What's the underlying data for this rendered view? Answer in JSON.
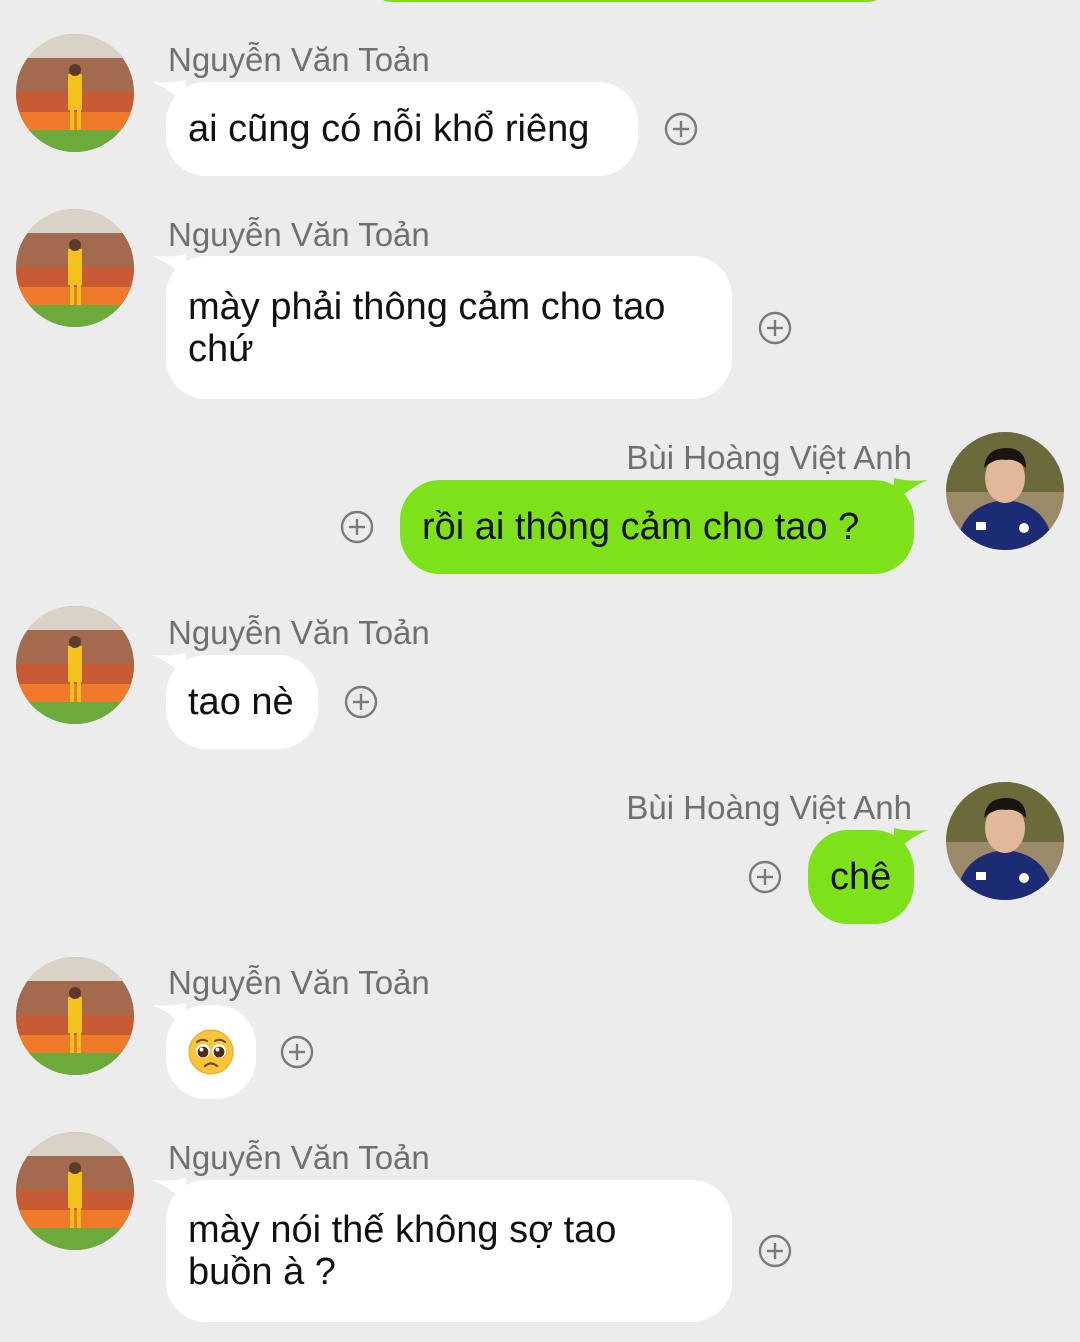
{
  "colors": {
    "background": "#ececec",
    "incoming_bubble": "#ffffff",
    "outgoing_bubble": "#7ee21a",
    "sender_text": "#707070"
  },
  "messages": [
    {
      "sender": "Nguyễn Văn Toản",
      "text": "ai cũng có nỗi khổ riêng",
      "direction": "incoming"
    },
    {
      "sender": "Nguyễn Văn Toản",
      "text": "mày phải thông cảm cho tao chứ",
      "direction": "incoming"
    },
    {
      "sender": "Bùi Hoàng Việt Anh",
      "text": "rồi ai thông cảm cho tao ?",
      "direction": "outgoing"
    },
    {
      "sender": "Nguyễn Văn Toản",
      "text": "tao nè",
      "direction": "incoming"
    },
    {
      "sender": "Bùi Hoàng Việt Anh",
      "text": "chê",
      "direction": "outgoing"
    },
    {
      "sender": "Nguyễn Văn Toản",
      "emoji": "pleading-face-emoji",
      "direction": "incoming"
    },
    {
      "sender": "Nguyễn Văn Toản",
      "text": "mày nói thế không sợ tao buồn à ?",
      "direction": "incoming"
    }
  ],
  "icons": {
    "reaction": "plus-circle-icon",
    "avatar_incoming": "avatar-goalkeeper-photo",
    "avatar_outgoing": "avatar-portrait-photo"
  }
}
